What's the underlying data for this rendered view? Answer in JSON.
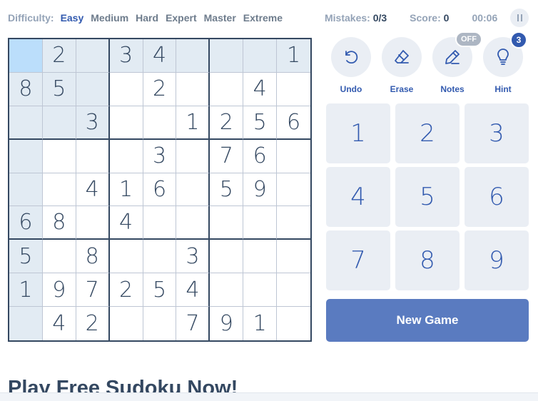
{
  "difficulty": {
    "label": "Difficulty:",
    "items": [
      "Easy",
      "Medium",
      "Hard",
      "Expert",
      "Master",
      "Extreme"
    ],
    "active": "Easy"
  },
  "stats": {
    "mistakes_label": "Mistakes:",
    "mistakes_value": "0/3",
    "score_label": "Score:",
    "score_value": "0",
    "timer": "00:06"
  },
  "board": [
    [
      "",
      "2",
      "",
      "3",
      "4",
      "",
      "",
      "",
      "1"
    ],
    [
      "8",
      "5",
      "",
      "",
      "2",
      "",
      "",
      "4",
      ""
    ],
    [
      "",
      "",
      "3",
      "",
      "",
      "1",
      "2",
      "5",
      "6"
    ],
    [
      "",
      "",
      "",
      "",
      "3",
      "",
      "7",
      "6",
      ""
    ],
    [
      "",
      "",
      "4",
      "1",
      "6",
      "",
      "5",
      "9",
      ""
    ],
    [
      "6",
      "8",
      "",
      "4",
      "",
      "",
      "",
      "",
      ""
    ],
    [
      "5",
      "",
      "8",
      "",
      "",
      "3",
      "",
      "",
      ""
    ],
    [
      "1",
      "9",
      "7",
      "2",
      "5",
      "4",
      "",
      "",
      ""
    ],
    [
      "",
      "4",
      "2",
      "",
      "",
      "7",
      "9",
      "1",
      ""
    ]
  ],
  "selected_cell": {
    "row": 1,
    "col": 1
  },
  "tools": {
    "undo": "Undo",
    "erase": "Erase",
    "notes": "Notes",
    "notes_state": "OFF",
    "hint": "Hint",
    "hint_count": "3"
  },
  "numpad": [
    "1",
    "2",
    "3",
    "4",
    "5",
    "6",
    "7",
    "8",
    "9"
  ],
  "new_game_label": "New Game",
  "section_heading": "Play Free Sudoku Now!",
  "colors": {
    "accent": "#325aaf",
    "new_game_bg": "#5a7bc0",
    "highlight": "#e2ebf3",
    "selected": "#bbdefb"
  }
}
